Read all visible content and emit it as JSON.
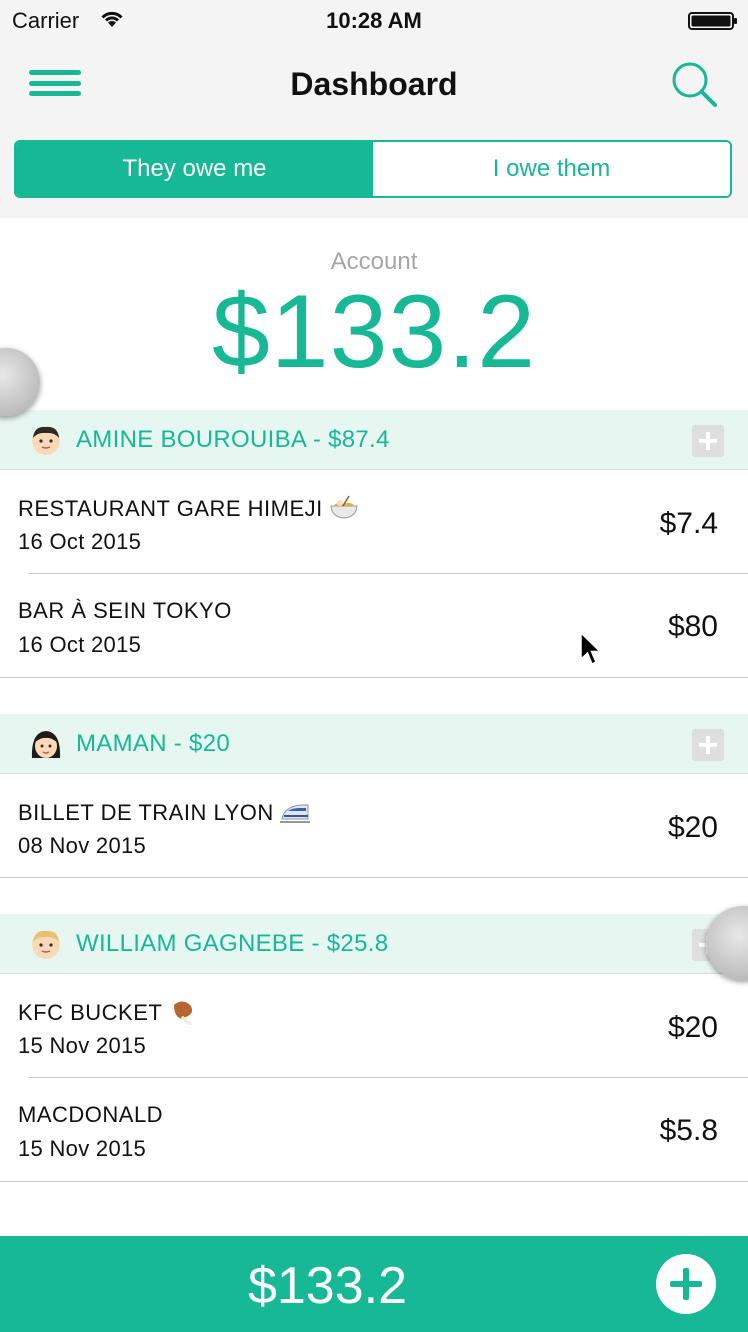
{
  "status_bar": {
    "carrier": "Carrier",
    "time": "10:28 AM"
  },
  "nav": {
    "title": "Dashboard",
    "left_icon": "hamburger-menu-icon",
    "right_icon": "search-icon"
  },
  "segments": {
    "active": "They owe me",
    "inactive": "I owe them"
  },
  "account": {
    "label": "Account",
    "amount": "$133.2"
  },
  "groups": [
    {
      "name": "AMINE BOUROUIBA - $87.4",
      "avatar": "man-face-icon",
      "items": [
        {
          "title": "RESTAURANT GARE HIMEJI",
          "emoji": "noodle-bowl-icon",
          "date": "16 Oct 2015",
          "amount": "$7.4"
        },
        {
          "title": "BAR À SEIN TOKYO",
          "date": "16 Oct 2015",
          "amount": "$80"
        }
      ]
    },
    {
      "name": "MAMAN - $20",
      "avatar": "woman-face-icon",
      "items": [
        {
          "title": "BILLET DE TRAIN LYON",
          "emoji": "bullet-train-icon",
          "date": "08 Nov 2015",
          "amount": "$20"
        }
      ]
    },
    {
      "name": "WILLIAM GAGNEBE - $25.8",
      "avatar": "blond-man-face-icon",
      "items": [
        {
          "title": "KFC BUCKET",
          "emoji": "chicken-leg-icon",
          "date": "15 Nov 2015",
          "amount": "$20"
        },
        {
          "title": "MACDONALD",
          "date": "15 Nov 2015",
          "amount": "$5.8"
        }
      ]
    }
  ],
  "bottom_bar": {
    "total": "$133.2",
    "add_icon": "add-circle-icon"
  },
  "colors": {
    "accent": "#16b896",
    "group_header_bg": "#e6f6f1",
    "label_gray": "#a6a6a6"
  }
}
